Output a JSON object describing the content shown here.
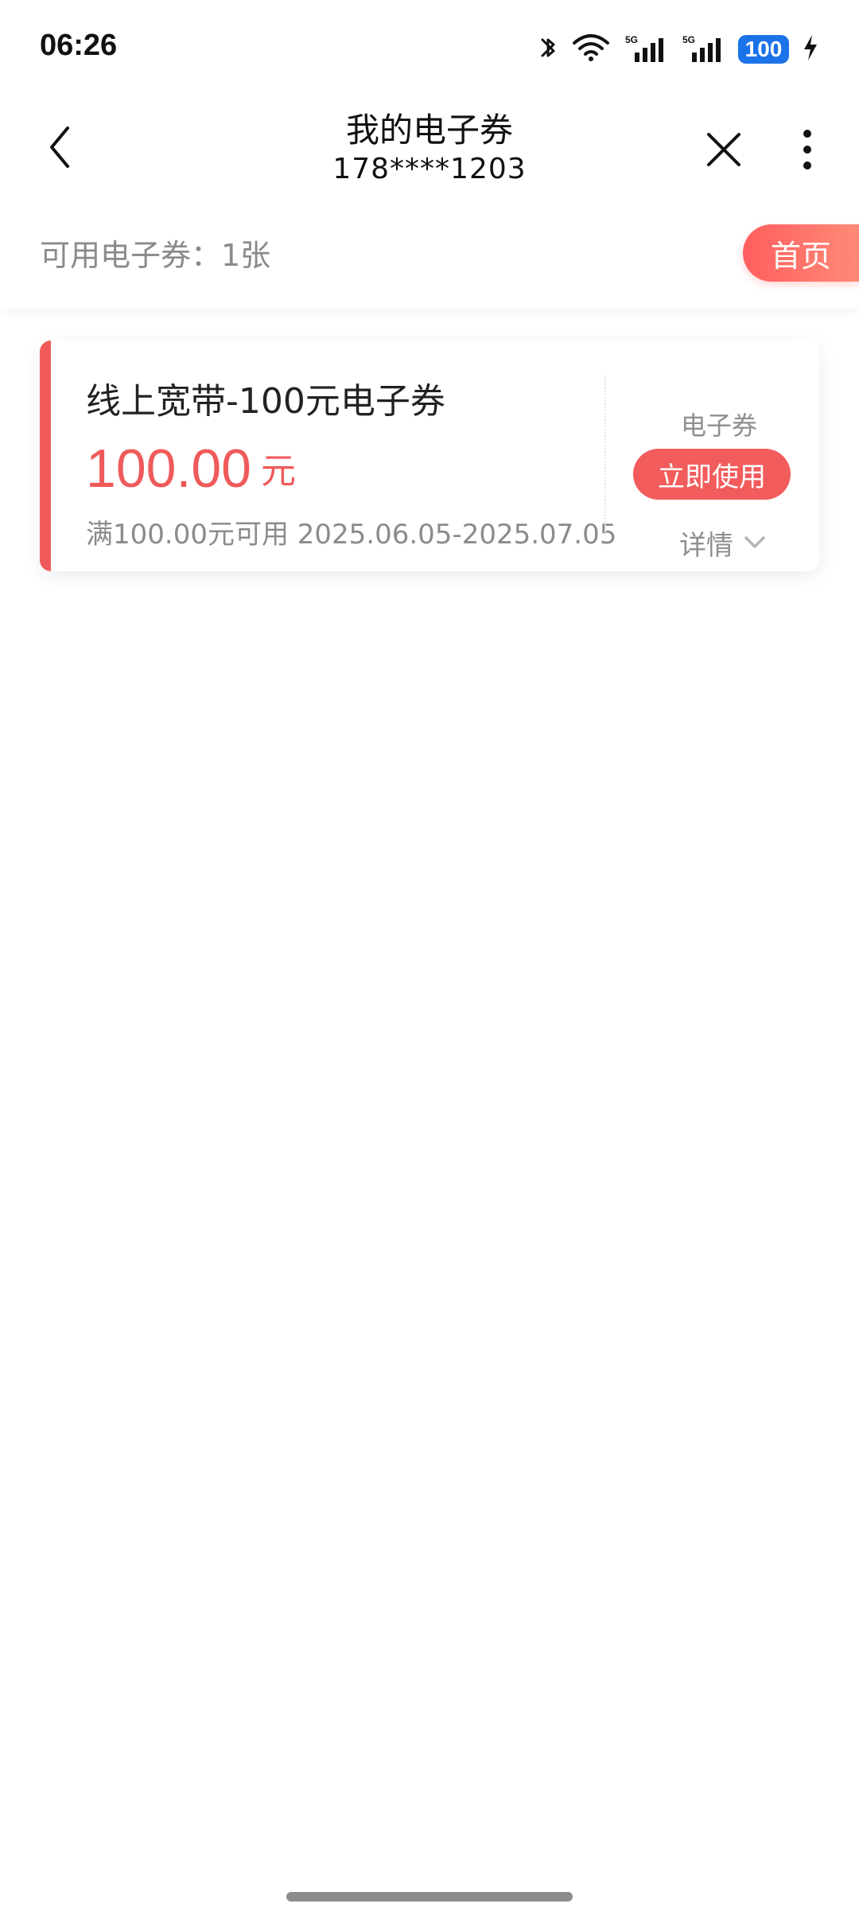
{
  "status": {
    "time": "06:26",
    "battery": "100",
    "icons": [
      "bluetooth-icon",
      "wifi-icon",
      "5g-signal-icon",
      "5g-signal-icon",
      "battery-icon",
      "charging-icon"
    ]
  },
  "header": {
    "title": "我的电子券",
    "subtitle": "178****1203"
  },
  "summary": {
    "text": "可用电子券：1张",
    "home_button": "首页"
  },
  "coupon": {
    "title": "线上宽带-100元电子券",
    "amount": "100.00",
    "unit": "元",
    "condition": "满100.00元可用 2025.06.05-2025.07.05",
    "type": "电子券",
    "use_button": "立即使用",
    "details": "详情"
  },
  "colors": {
    "accent": "#f05a5a",
    "battery": "#1a73e8"
  }
}
